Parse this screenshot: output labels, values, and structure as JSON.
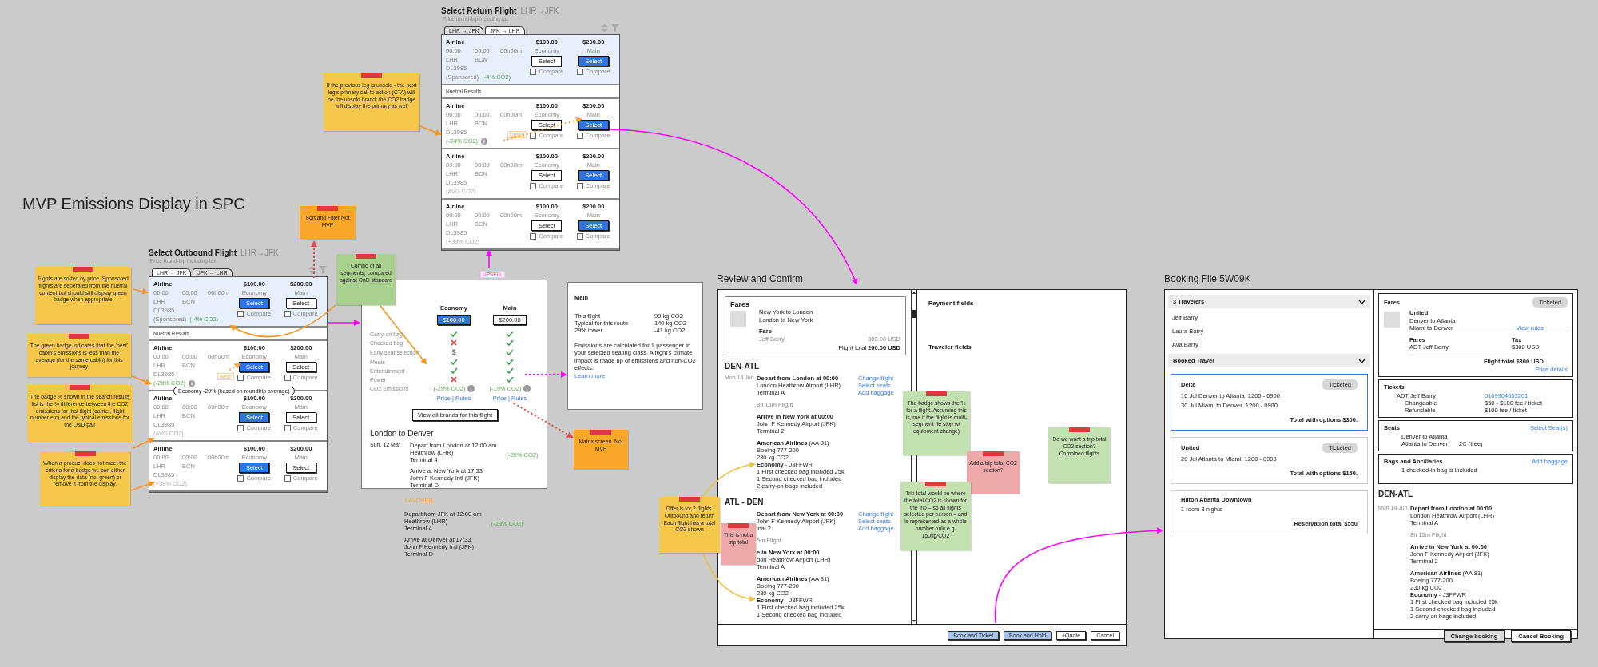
{
  "canvas_title": "MVP Emissions Display in SPC",
  "searches": [
    {
      "title": "Select Outbound Flight",
      "route": "LHR→JFK",
      "subtitle": "Price round-trip including tax",
      "tabs": [
        {
          "label": "LHR → JFK",
          "selected": true
        },
        {
          "label": "JFK → LHR",
          "selected": false
        }
      ],
      "sponsored_flights": [
        {
          "airline": "Airline",
          "depart": "00:00",
          "arrive": "00:00",
          "duration": "00h00m",
          "origin": "LHR",
          "destination": "BCN",
          "number": "DL3985",
          "sponsored_label": "(Sponsored)",
          "badge": "(-4% CO2)",
          "badge_positive": true,
          "info": false,
          "fares": [
            {
              "price": "$100.00",
              "cabin": "Economy",
              "button": "Select",
              "primary": true,
              "compare": "Compare",
              "checked": false
            },
            {
              "price": "$200.00",
              "cabin": "Main",
              "button": "Select",
              "primary": false,
              "compare": "Compare",
              "checked": false
            }
          ]
        }
      ],
      "neutral_label": "Nuetral Results",
      "neutral_flights": [
        {
          "airline": "Airline",
          "depart": "00:00",
          "arrive": "00:00",
          "duration": "00h00m",
          "origin": "LHR",
          "destination": "BCN",
          "number": "DL3985",
          "badge": "(-29% CO2)",
          "badge_positive": true,
          "info": true,
          "tag": "Best!",
          "tooltip": "Economy -29% (based on roundtrip average)",
          "fares": [
            {
              "price": "$100.00",
              "cabin": "Economy",
              "button": "Select",
              "primary": true,
              "compare": "Compare",
              "checked": false
            },
            {
              "price": "$200.00",
              "cabin": "Main",
              "button": "Select",
              "primary": false,
              "compare": "Compare",
              "checked": false
            }
          ]
        },
        {
          "airline": "Airline",
          "depart": "00:00",
          "arrive": "00:00",
          "duration": "00h00m",
          "origin": "LHR",
          "destination": "BCN",
          "number": "DL3985",
          "badge": "(AVG CO2)",
          "badge_positive": false,
          "info": false,
          "fares": [
            {
              "price": "$100.00",
              "cabin": "Economy",
              "button": "Select",
              "primary": true,
              "compare": "Compare",
              "checked": false
            },
            {
              "price": "$200.00",
              "cabin": "Main",
              "button": "Select",
              "primary": false,
              "compare": "Compare",
              "checked": false
            }
          ]
        },
        {
          "airline": "Airline",
          "depart": "00:00",
          "arrive": "00:00",
          "duration": "00h00m",
          "origin": "LHR",
          "destination": "BCN",
          "number": "DL3985",
          "badge": "(+39% CO2)",
          "badge_positive": false,
          "info": false,
          "fares": [
            {
              "price": "$100.00",
              "cabin": "Economy",
              "button": "Select",
              "primary": true,
              "compare": "Compare",
              "checked": false
            },
            {
              "price": "$200.00",
              "cabin": "Main",
              "button": "Select",
              "primary": false,
              "compare": "Compare",
              "checked": false
            }
          ]
        }
      ]
    },
    {
      "title": "Select Return Flight",
      "route": "LHR→JFK",
      "subtitle": "Price round-trip including tax",
      "tabs": [
        {
          "label": "LHR → JFK",
          "selected": false
        },
        {
          "label": "JFK → LHR",
          "selected": true
        }
      ],
      "sponsored_flights": [
        {
          "airline": "Airline",
          "depart": "00:00",
          "arrive": "00:00",
          "duration": "00h00m",
          "origin": "LHR",
          "destination": "BCN",
          "number": "DL3985",
          "sponsored_label": "(Sponsored)",
          "badge": "(-4% CO2)",
          "badge_positive": true,
          "info": false,
          "fares": [
            {
              "price": "$100.00",
              "cabin": "Economy",
              "button": "Select",
              "primary": false,
              "compare": "Compare",
              "checked": false
            },
            {
              "price": "$200.00",
              "cabin": "Main",
              "button": "Select",
              "primary": true,
              "compare": "Compare",
              "checked": false
            }
          ]
        }
      ],
      "neutral_label": "Nuetral Results",
      "neutral_flights": [
        {
          "airline": "Airline",
          "depart": "00:00",
          "arrive": "00:00",
          "duration": "00h00m",
          "origin": "LHR",
          "destination": "BCN",
          "number": "DL3985",
          "badge": "(-24% CO2)",
          "badge_positive": true,
          "info": true,
          "tag": "Upsell",
          "fares": [
            {
              "price": "$100.00",
              "cabin": "Economy",
              "button": "Select",
              "primary": false,
              "compare": "Compare",
              "checked": false
            },
            {
              "price": "$200.00",
              "cabin": "Main",
              "button": "Select",
              "primary": true,
              "compare": "Compare",
              "checked": false
            }
          ]
        },
        {
          "airline": "Airline",
          "depart": "00:00",
          "arrive": "00:00",
          "duration": "00h00m",
          "origin": "LHR",
          "destination": "BCN",
          "number": "DL3985",
          "badge": "(AVG CO2)",
          "badge_positive": false,
          "info": false,
          "fares": [
            {
              "price": "$100.00",
              "cabin": "Economy",
              "button": "Select",
              "primary": false,
              "compare": "Compare",
              "checked": false
            },
            {
              "price": "$200.00",
              "cabin": "Main",
              "button": "Select",
              "primary": true,
              "compare": "Compare",
              "checked": false
            }
          ]
        },
        {
          "airline": "Airline",
          "depart": "00:00",
          "arrive": "00:00",
          "duration": "00h00m",
          "origin": "LHR",
          "destination": "BCN",
          "number": "DL3985",
          "badge": "(+39% CO2)",
          "badge_positive": false,
          "info": false,
          "fares": [
            {
              "price": "$100.00",
              "cabin": "Economy",
              "button": "Select",
              "primary": false,
              "compare": "Compare",
              "checked": false
            },
            {
              "price": "$200.00",
              "cabin": "Main",
              "button": "Select",
              "primary": true,
              "compare": "Compare",
              "checked": false
            }
          ]
        }
      ]
    }
  ],
  "brand_detail": {
    "upsell_label": "UPSELL",
    "brands": [
      {
        "name": "Economy",
        "price": "$100.00",
        "primary": true,
        "badge": "(-29% CO2)",
        "links": "Price | Rules"
      },
      {
        "name": "Main",
        "price": "$200.00",
        "primary": false,
        "badge": "(-19% CO2)",
        "links": "Price | Rules"
      }
    ],
    "features": [
      {
        "label": "Carry-on bag",
        "values": [
          {
            "kind": "included"
          },
          {
            "kind": "included"
          }
        ]
      },
      {
        "label": "Checked bag",
        "values": [
          {
            "kind": "excluded"
          },
          {
            "kind": "included"
          }
        ]
      },
      {
        "label": "Early-seat selection",
        "values": [
          {
            "kind": "paid",
            "text": "$"
          },
          {
            "kind": "included"
          }
        ]
      },
      {
        "label": "Meals",
        "values": [
          {
            "kind": "included"
          },
          {
            "kind": "included"
          }
        ]
      },
      {
        "label": "Entertainment",
        "values": [
          {
            "kind": "included"
          },
          {
            "kind": "included"
          }
        ]
      },
      {
        "label": "Power",
        "values": [
          {
            "kind": "excluded"
          },
          {
            "kind": "included"
          }
        ]
      }
    ],
    "emissions_label": "CO2 Emissions",
    "view_all_button": "View all brands for this flight",
    "journey_title": "London to Denver",
    "date": "Sun, 12 Mar",
    "segments": [
      {
        "depart": [
          "Depart from London at 12:00 am",
          "Heathrow (LHR)",
          "Terminal 4"
        ],
        "badge": "(-29% CO2)",
        "arrive": [
          "Arrive at New York at 17:33",
          "John F Kennedy Intl (JFK)",
          "Terminal D"
        ]
      },
      {
        "depart": [
          "Depart from JFK at 12:00 am",
          "Heathrow (LHR)",
          "Terminal 4"
        ],
        "badge": "(-29% CO2)",
        "arrive": [
          "Arrive at Denver at 17:33",
          "John F Kennedy Intl (JFK)",
          "Terminal D"
        ]
      }
    ],
    "layover_label": "LAYOVER"
  },
  "emissions_panel": {
    "title": "Main",
    "rows": [
      {
        "label": "This flight",
        "value": "99 kg CO2"
      },
      {
        "label": "Typical for this route",
        "value": "140 kg CO2"
      },
      {
        "label": "29% lower",
        "value": "-41 kg CO2"
      }
    ],
    "note": "Emissions are calculated for 1 passenger in your selected seating class. A flight's climate impact is made up of emissions and non-CO2 effects.",
    "link": "Learn more"
  },
  "review": {
    "title": "Review and Confirm",
    "fares": {
      "heading": "Fares",
      "routes": [
        "New York to London",
        "London to New York"
      ],
      "fare_label": "Fare",
      "passenger": "Jeff Barry",
      "amount": "300.00 USD",
      "total": "Flight total **200.00 USD**"
    },
    "legs": [
      {
        "route": "DEN-ATL",
        "date": "Mon 14 Jun",
        "links": [
          "Change flight",
          "Select seats",
          "Add baggage"
        ],
        "blocks": [
          {
            "kind": "stop",
            "title": "Depart from London at 00:00",
            "lines": [
              "London Heathrow Airport (LHR)",
              "Terminal A"
            ]
          },
          {
            "kind": "duration",
            "text": "8h 15m Flight"
          },
          {
            "kind": "stop",
            "title": "Arrive in New York at 00:00",
            "lines": [
              "John F Kennedy Airport (JFK)",
              "Terminal 2"
            ]
          },
          {
            "kind": "carrier",
            "lines": [
              "**American Airlines** (AA 81)",
              "Boeing 777-200",
              "230 kg CO2",
              "**Economy** - J3FFWR",
              "1 First checked bag included 25k",
              "1 Second checked bag included",
              "2 carry-on bags included"
            ]
          }
        ]
      },
      {
        "route": "ATL - DEN",
        "links": [
          "Change flight",
          "Select seats",
          "Add baggage"
        ],
        "blocks": [
          {
            "kind": "stop",
            "title": "Depart from New York at 00:00",
            "lines": [
              "John F Kennedy Airport (JFK)",
              "inal 2"
            ]
          },
          {
            "kind": "duration",
            "text": "5m Flight"
          },
          {
            "kind": "stop",
            "title": "e in New York at 00:00",
            "lines": [
              "don Heathrow Airport (LHR)",
              "Terminal A"
            ]
          },
          {
            "kind": "carrier",
            "lines": [
              "**American Airlines** (AA 81)",
              "Boeing 777-200",
              "230 kg CO2",
              "**Economy** - J3FFWR",
              "1 First checked bag included 25k",
              "1 Second checked bag included"
            ]
          }
        ]
      }
    ],
    "right_sections": [
      "Payment fields",
      "Traveler fields"
    ],
    "buttons": [
      {
        "label": "Book and Ticket",
        "primary": true
      },
      {
        "label": "Book and Hold",
        "primary": true
      },
      {
        "label": "+Quote",
        "primary": false
      },
      {
        "label": "Cancel",
        "primary": false
      }
    ]
  },
  "booking_file": {
    "title": "Booking File 5W09K",
    "travelers": {
      "heading": "3 Travelers",
      "expanded": true,
      "names": [
        "Jeff Barry",
        "Laura Barry",
        "Ava Barry"
      ]
    },
    "booked_travel": {
      "heading": "Booked Travel",
      "expanded": true,
      "items": [
        {
          "name": "Delta",
          "status": "Ticketed",
          "selected": true,
          "lines": [
            "10 Jul Denver to Atlanta  1200 - 0900",
            "30 Jul Miami to Denver  1200 - 0900"
          ],
          "total": "Total with options $300."
        },
        {
          "name": "United",
          "status": "Ticketed",
          "selected": false,
          "lines": [
            "20 Jul Atlanta to Miami  1200 - 0900"
          ],
          "total": "Total with options $150."
        },
        {
          "name": "Hilton Atlanta Downtown",
          "selected": false,
          "lines": [
            "1 room 3 nights"
          ],
          "total": "Reservation total $550"
        }
      ]
    },
    "fares": {
      "heading": "Fares",
      "status": "Ticketed",
      "carrier": "United",
      "routes": [
        "Denver to Atlanta",
        "Miami to Denver"
      ],
      "rules_link": "View rules",
      "fares_label": "Fares",
      "tax_label": "Tax",
      "passenger": "ADT Jeff Barry",
      "tax": "$300 USD",
      "total": "Flight total $300 USD",
      "details_link": "Price details"
    },
    "tickets": {
      "heading": "Tickets",
      "passenger": "ADT Jeff Barry",
      "number": "0169904653201",
      "rows": [
        {
          "label": "Changeable",
          "value": "$50 - $100 fee / ticket"
        },
        {
          "label": "Refundable",
          "value": "$100 fee / ticket"
        }
      ]
    },
    "seats": {
      "heading": "Seats",
      "link": "Select Seat(s)",
      "rows": [
        {
          "label": "Denver to Atlanta"
        },
        {
          "label": "Atlanta to Denver",
          "value": "2C (free)"
        }
      ]
    },
    "bags": {
      "heading": "Bags and Ancillaries",
      "link": "Add baggage",
      "text": "1 checked-in bag is included"
    },
    "leg": {
      "route": "DEN-ATL",
      "date": "Mon 14 Jun",
      "blocks": [
        {
          "kind": "stop",
          "title": "Depart from London at 00:00",
          "lines": [
            "London Heathrow Airport (LHR)",
            "Terminal A"
          ]
        },
        {
          "kind": "duration",
          "text": "8h 15m Flight"
        },
        {
          "kind": "stop",
          "title": "Arrive in New York at 00:00",
          "lines": [
            "John F Kennedy Airport (JFK)",
            "Terminal 2"
          ]
        },
        {
          "kind": "carrier",
          "lines": [
            "**American Airlines** (AA 81)",
            "Boeing 777-200",
            "230 kg CO2",
            "**Economy** - J3FFWR",
            "1 First checked bag included 25k",
            "1 Second checked bag included",
            "2 carry-on bags included"
          ]
        }
      ]
    },
    "buttons": [
      {
        "label": "Change booking",
        "primary": true
      },
      {
        "label": "Cancel Booking",
        "primary": false
      }
    ]
  },
  "sticky_notes": [
    {
      "text": "Fights are sorted by price. Sponsored flights are seperated from the nuetral content but should still display green badge when appropriate",
      "color": "#f5c84c"
    },
    {
      "text": "The green badge indicates that the 'best' cabin's emissions is less than the average (for the same cabin) for this journey",
      "color": "#f5c84c"
    },
    {
      "text": "The badge % shown in the search results list is the % difference between the CO2 emissions for that flight (carrier, flight number etc) and the typical emissions for the O&D pair",
      "color": "#f5c84c"
    },
    {
      "text": "When a product does not meet the criteria for a badge we can either display the data (not green) or remove it from the display.",
      "color": "#f5c84c"
    },
    {
      "text": "If the previous leg is upsold - the next leg's primary call to action (CTA) will be the upsold brand; the CO2 badge will display the primary as well",
      "color": "#f5c84c"
    },
    {
      "text": "Sort and Filter Not MVP",
      "color": "#f9a72b"
    },
    {
      "text": "Combo of all segments, compared against OnD standard",
      "color": "#a9d08e"
    },
    {
      "text": "Matrix screen. Not MVP",
      "color": "#f9a72b"
    },
    {
      "text": "Offer is for 2 flights. Outbound and return Each flight has a total CO2 shown",
      "color": "#f5c84c"
    },
    {
      "text": "This is not a trip total",
      "color": "#eeaaaa"
    },
    {
      "text": "The badge shows the % for a flight. Assuming this is true if the flight is multi-segment (ie stop w/ equipment change)",
      "color": "#c3e0b0"
    },
    {
      "text": "Add a trip total CO2 section?",
      "color": "#eeaaaa"
    },
    {
      "text": "Trip total would be where the total CO2 is shown for the trip – so all flights selected per person – and is represented as a whole number only e.g. 150kg/CO2",
      "color": "#c3e0b0"
    },
    {
      "text": "Do we want a trip total CO2 section? Combined flights",
      "color": "#c3e0b0"
    }
  ]
}
